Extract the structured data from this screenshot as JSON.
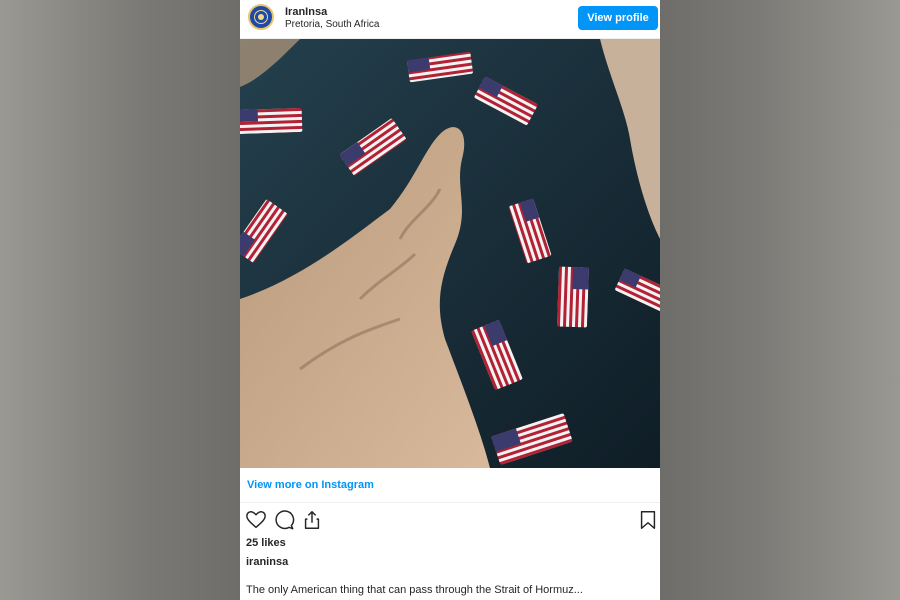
{
  "post": {
    "username": "IranInsa",
    "location": "Pretoria, South Africa",
    "view_profile_label": "View profile",
    "view_more_label": "View more on Instagram",
    "likes": "25 likes",
    "caption_username": "iraninsa",
    "caption": "The only American thing that can pass through the Strait of Hormuz..."
  },
  "icons": {
    "like": "heart-icon",
    "comment": "comment-icon",
    "share": "share-icon",
    "save": "bookmark-icon"
  },
  "colors": {
    "accent": "#0095f6",
    "text": "#262626",
    "water": "#1b2f3a",
    "land": "#c9a98a"
  }
}
